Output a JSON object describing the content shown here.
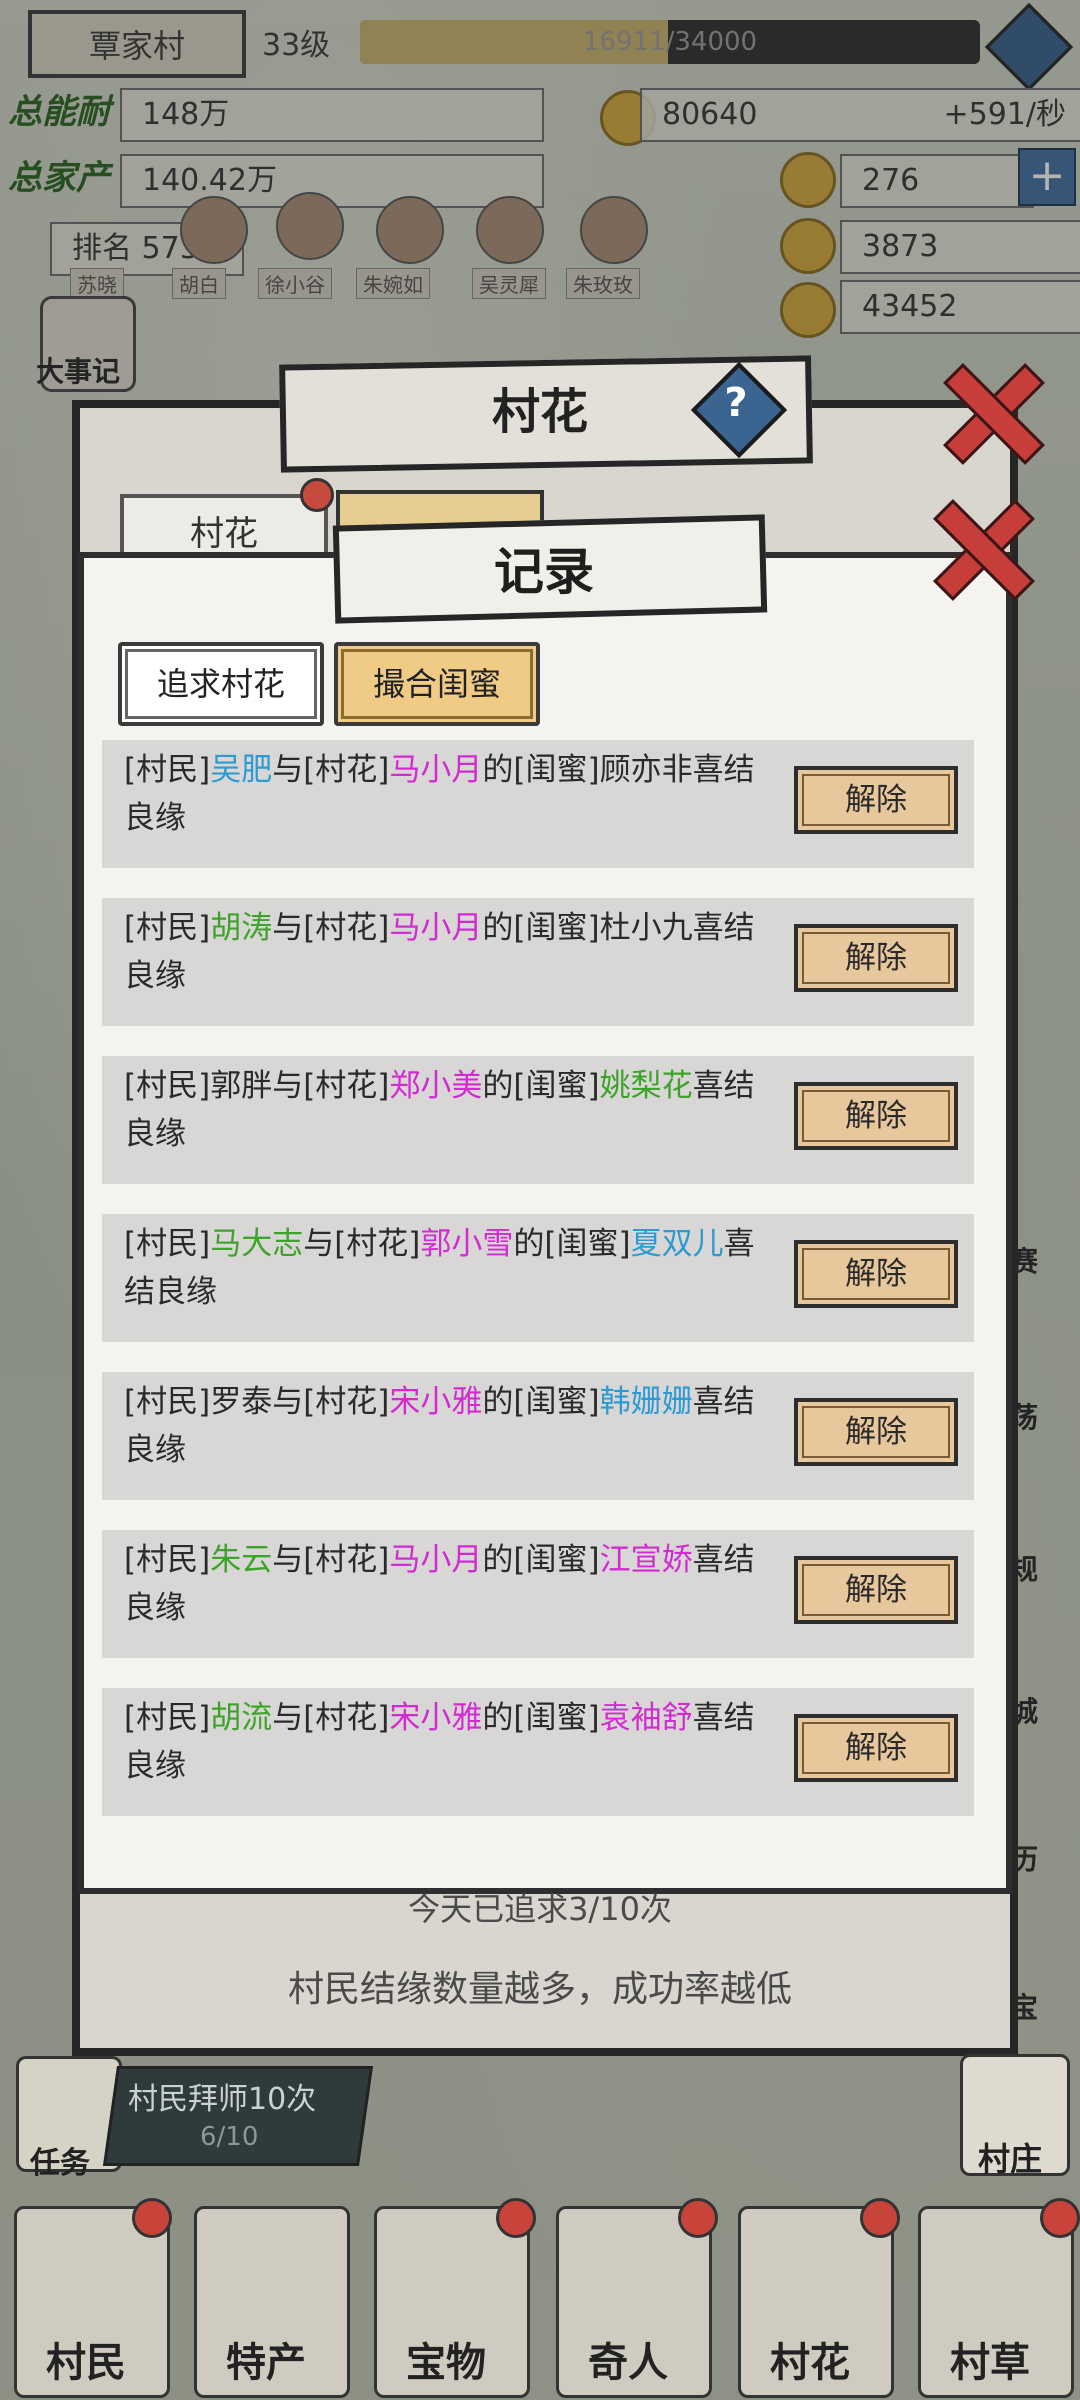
{
  "top": {
    "village_name": "覃家村",
    "level": "33级",
    "xp_text": "16911/34000",
    "xp_fraction": 0.497
  },
  "stats": {
    "total_ability_label": "总能耐",
    "total_ability_value": "148万",
    "total_fortune_label": "总家产",
    "total_fortune_value": "140.42万",
    "rank_label": "排名",
    "rank_value": "573",
    "coins": "80640",
    "coins_rate": "+591/秒",
    "ingots": "276",
    "tickets": "3873",
    "silver": "43452"
  },
  "villagers_strip": [
    "苏晓",
    "胡白",
    "徐小谷",
    "朱婉如",
    "吴灵犀",
    "朱玫玫"
  ],
  "side_left": {
    "chronicle": "大事记"
  },
  "back_modal": {
    "title": "村花",
    "help_glyph": "?",
    "tab1": "村花"
  },
  "modal": {
    "title": "记录",
    "tab_pursue": "追求村花",
    "tab_match": "撮合闺蜜",
    "release_label": "解除",
    "records": [
      {
        "p1": "[村民]",
        "villager": "吴肥",
        "villager_color": "blue",
        "p2": "与[村花]",
        "flower": "马小月",
        "p3": "的[闺蜜]",
        "friend": "顾亦非",
        "friend_color": "plain",
        "p4": "喜结良缘"
      },
      {
        "p1": "[村民]",
        "villager": "胡涛",
        "villager_color": "green",
        "p2": "与[村花]",
        "flower": "马小月",
        "p3": "的[闺蜜]",
        "friend": "杜小九",
        "friend_color": "plain",
        "p4": "喜结良缘"
      },
      {
        "p1": "[村民]",
        "villager": "郭胖",
        "villager_color": "plain",
        "p2": "与[村花]",
        "flower": "郑小美",
        "p3": "的[闺蜜]",
        "friend": "姚梨花",
        "friend_color": "green",
        "p4": "喜结良缘"
      },
      {
        "p1": "[村民]",
        "villager": "马大志",
        "villager_color": "green",
        "p2": "与[村花]",
        "flower": "郭小雪",
        "p3": "的[闺蜜]",
        "friend": "夏双儿",
        "friend_color": "blue",
        "p4": "喜结良缘"
      },
      {
        "p1": "[村民]",
        "villager": "罗泰",
        "villager_color": "plain",
        "p2": "与[村花]",
        "flower": "宋小雅",
        "p3": "的[闺蜜]",
        "friend": "韩姗姗",
        "friend_color": "blue",
        "p4": "喜结良缘"
      },
      {
        "p1": "[村民]",
        "villager": "朱云",
        "villager_color": "green",
        "p2": "与[村花]",
        "flower": "马小月",
        "p3": "的[闺蜜]",
        "friend": "江宣娇",
        "friend_color": "pink",
        "p4": "喜结良缘"
      },
      {
        "p1": "[村民]",
        "villager": "胡流",
        "villager_color": "green",
        "p2": "与[村花]",
        "flower": "宋小雅",
        "p3": "的[闺蜜]",
        "friend": "袁袖舒",
        "friend_color": "pink",
        "p4": "喜结良缘"
      }
    ]
  },
  "footer": {
    "pursue_count": "今天已追求3/10次",
    "tip": "村民结缘数量越多，成功率越低"
  },
  "task": {
    "label": "任务",
    "title": "村民拜师10次",
    "progress": "6/10"
  },
  "village_button": "村庄",
  "right_side_labels": [
    "赛",
    "荡",
    "规",
    "城",
    "历",
    "宝"
  ],
  "bottom_nav": [
    "村民",
    "特产",
    "宝物",
    "奇人",
    "村花",
    "村草"
  ],
  "colors": {
    "blue": "#2c9ad3",
    "pink": "#d12bd1",
    "green": "#3ea32a",
    "release_button": "#e7c79c",
    "tab_active": "#ffffff",
    "tab_inactive": "#efcb85",
    "close_red": "#c63d3a"
  }
}
